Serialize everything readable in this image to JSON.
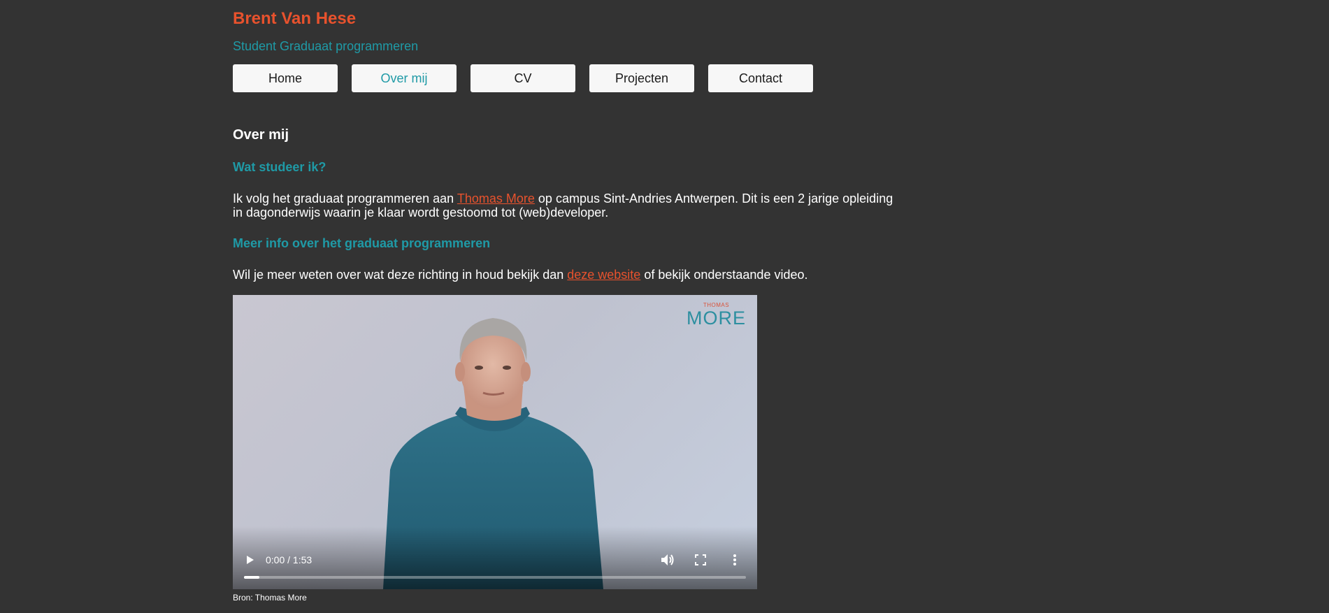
{
  "header": {
    "title": "Brent Van Hese",
    "subtitle": "Student Graduaat programmeren"
  },
  "nav": {
    "items": [
      {
        "label": "Home",
        "active": false
      },
      {
        "label": "Over mij",
        "active": true
      },
      {
        "label": "CV",
        "active": false
      },
      {
        "label": "Projecten",
        "active": false
      },
      {
        "label": "Contact",
        "active": false
      }
    ]
  },
  "main": {
    "heading": "Over mij",
    "section1": {
      "heading": "Wat studeer ik?",
      "text_before": "Ik volg het graduaat programmeren aan ",
      "link": "Thomas More",
      "text_after": " op campus Sint-Andries Antwerpen. Dit is een 2 jarige opleiding in dagonderwijs waarin je klaar wordt gestoomd tot (web)developer."
    },
    "section2": {
      "heading": "Meer info over het graduaat programmeren",
      "text_before": "Wil je meer weten over wat deze richting in houd bekijk dan ",
      "link": "deze website",
      "text_after": " of bekijk onderstaande video."
    },
    "video": {
      "logo_small": "THOMAS",
      "logo_big": "MORE",
      "time": "0:00 / 1:53",
      "progress": 0.03,
      "play_icon": "play-icon",
      "volume_icon": "volume-icon",
      "fullscreen_icon": "fullscreen-icon",
      "more_icon": "more-vert-icon"
    },
    "caption": "Bron: Thomas More"
  },
  "colors": {
    "background": "#333333",
    "accent_orange": "#e8522d",
    "accent_teal": "#1f9aa6",
    "button_bg": "#f7f7f7"
  }
}
